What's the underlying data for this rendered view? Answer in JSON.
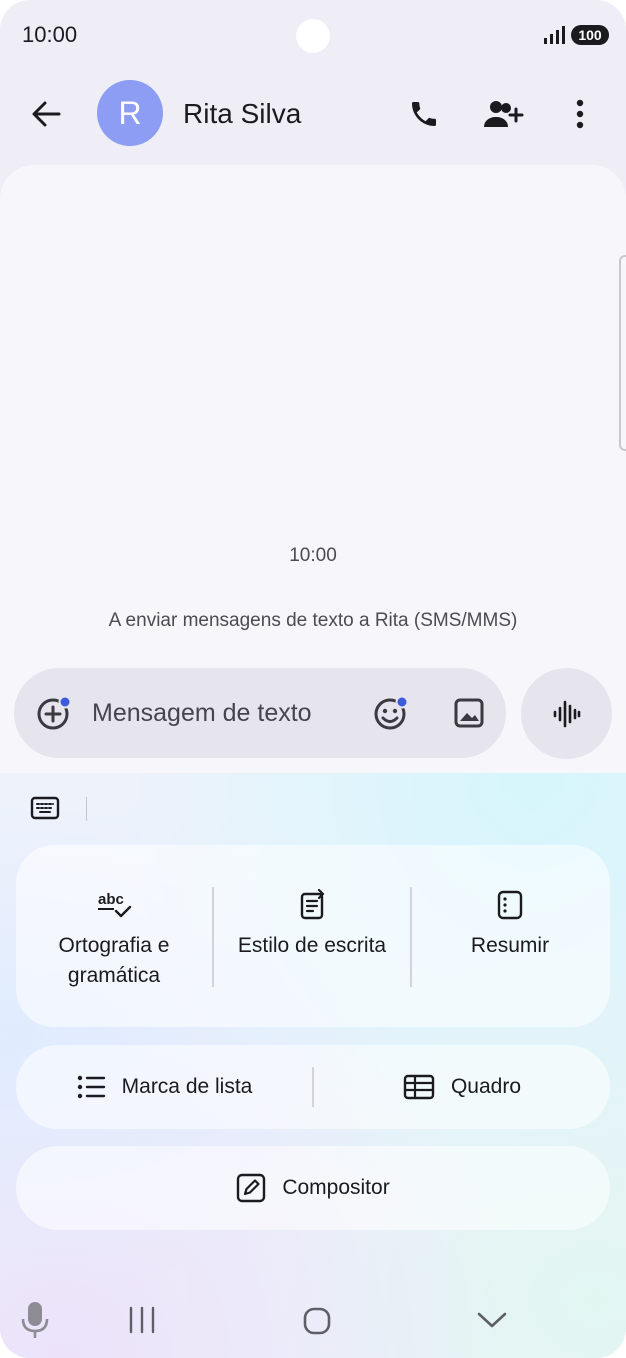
{
  "status_bar": {
    "time": "10:00",
    "battery": "100"
  },
  "header": {
    "avatar_letter": "R",
    "contact_name": "Rita Silva",
    "icons": [
      "back-arrow-icon",
      "phone-icon",
      "add-contact-icon",
      "more-vert-icon"
    ]
  },
  "conversation": {
    "timestamp": "10:00",
    "sms_info": "A enviar mensagens de texto a Rita (SMS/MMS)"
  },
  "composer": {
    "placeholder": "Mensagem de texto",
    "icons": [
      "add-attachment-icon",
      "emoji-icon",
      "gallery-icon",
      "voice-waveform-icon"
    ]
  },
  "writing_tools": {
    "keyboard_icon": "keyboard-icon",
    "grammar_label": "Ortografia e gramática",
    "style_label": "Estilo de escrita",
    "summarize_label": "Resumir",
    "bullet_label": "Marca de lista",
    "table_label": "Quadro",
    "composer_label": "Compositor"
  },
  "nav_bar": {
    "icons": [
      "mic-icon",
      "recent-apps-icon",
      "home-icon",
      "hide-keyboard-icon"
    ]
  },
  "colors": {
    "avatar": "#8c9df3",
    "accent_dot": "#3b5bdb",
    "text_primary": "#1b1b1f"
  }
}
